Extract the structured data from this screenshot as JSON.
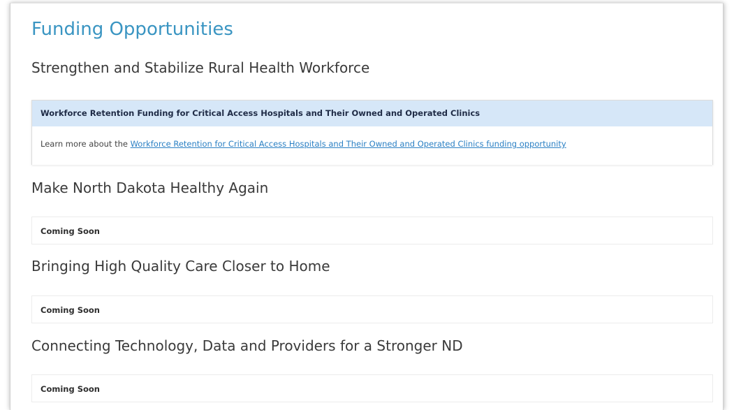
{
  "page": {
    "title": "Funding Opportunities"
  },
  "sections": [
    {
      "heading": "Strengthen and Stabilize Rural Health Workforce",
      "panel": {
        "title": "Workforce Retention Funding for Critical Access Hospitals and Their Owned and Operated Clinics",
        "body_prefix": "Learn more about the ",
        "link_text": "Workforce Retention for Critical Access Hospitals and Their Owned and Operated Clinics funding opportunity"
      }
    },
    {
      "heading": "Make North Dakota Healthy Again",
      "status": "Coming Soon"
    },
    {
      "heading": "Bringing High Quality Care Closer to Home",
      "status": "Coming Soon"
    },
    {
      "heading": "Connecting Technology, Data and Providers for a Stronger ND",
      "status": "Coming Soon"
    }
  ],
  "colors": {
    "title": "#3a95c2",
    "panel_header_bg": "#d6e7f8",
    "link": "#2b80c4"
  }
}
